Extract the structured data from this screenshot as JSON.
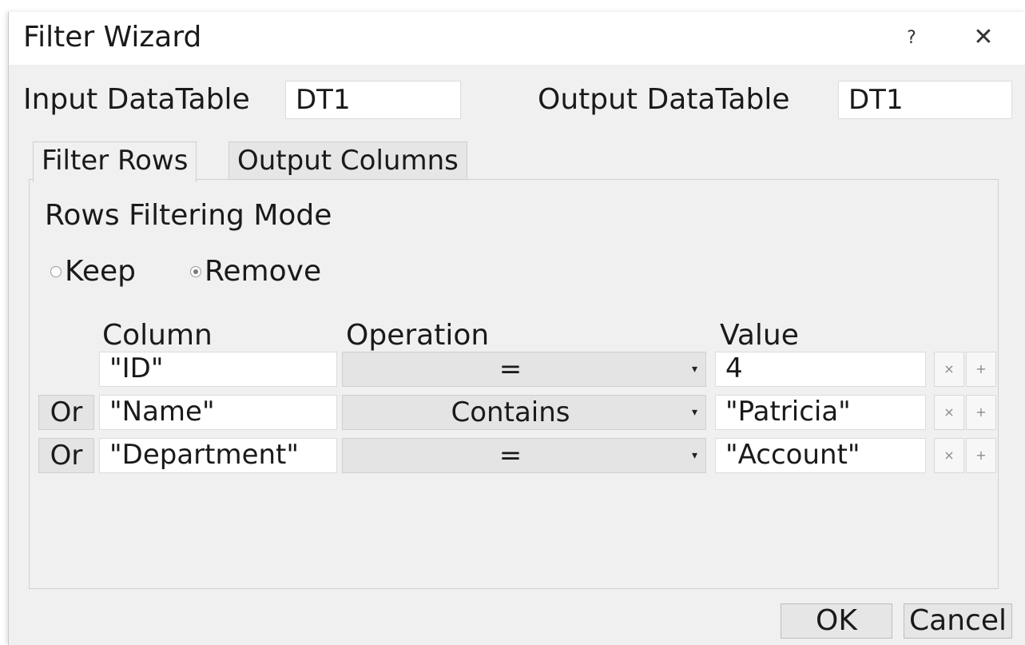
{
  "window": {
    "title": "Filter Wizard",
    "help_label": "?",
    "close_label": "✕"
  },
  "io": {
    "input_label": "Input DataTable",
    "input_value": "DT1",
    "output_label": "Output DataTable",
    "output_value": "DT1"
  },
  "tabs": [
    {
      "label": "Filter Rows",
      "active": true
    },
    {
      "label": "Output Columns",
      "active": false
    }
  ],
  "filter": {
    "mode_label": "Rows Filtering Mode",
    "keep_label": "Keep",
    "remove_label": "Remove",
    "selected_mode": "Remove",
    "headers": {
      "column": "Column",
      "operation": "Operation",
      "value": "Value"
    },
    "rows": [
      {
        "connector": "",
        "column": "\"ID\"",
        "operation": "=",
        "value": "4"
      },
      {
        "connector": "Or",
        "column": "\"Name\"",
        "operation": "Contains",
        "value": "\"Patricia\""
      },
      {
        "connector": "Or",
        "column": "\"Department\"",
        "operation": "=",
        "value": "\"Account\""
      }
    ],
    "remove_row_label": "×",
    "add_row_label": "+",
    "dropdown_icon": "▾"
  },
  "footer": {
    "ok_label": "OK",
    "cancel_label": "Cancel"
  }
}
